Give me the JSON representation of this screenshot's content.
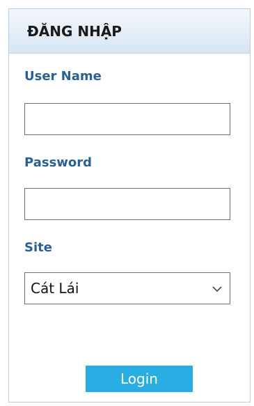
{
  "panel": {
    "title": "ĐĂNG NHẬP"
  },
  "form": {
    "username": {
      "label": "User Name",
      "value": "",
      "placeholder": ""
    },
    "password": {
      "label": "Password",
      "value": "",
      "placeholder": ""
    },
    "site": {
      "label": "Site",
      "selected": "Cát Lái"
    },
    "login_label": "Login"
  },
  "colors": {
    "label": "#2a6093",
    "button": "#29aee3",
    "header_bg": "#e3edf6"
  },
  "icons": {
    "site_dropdown": "chevron-down-icon"
  }
}
